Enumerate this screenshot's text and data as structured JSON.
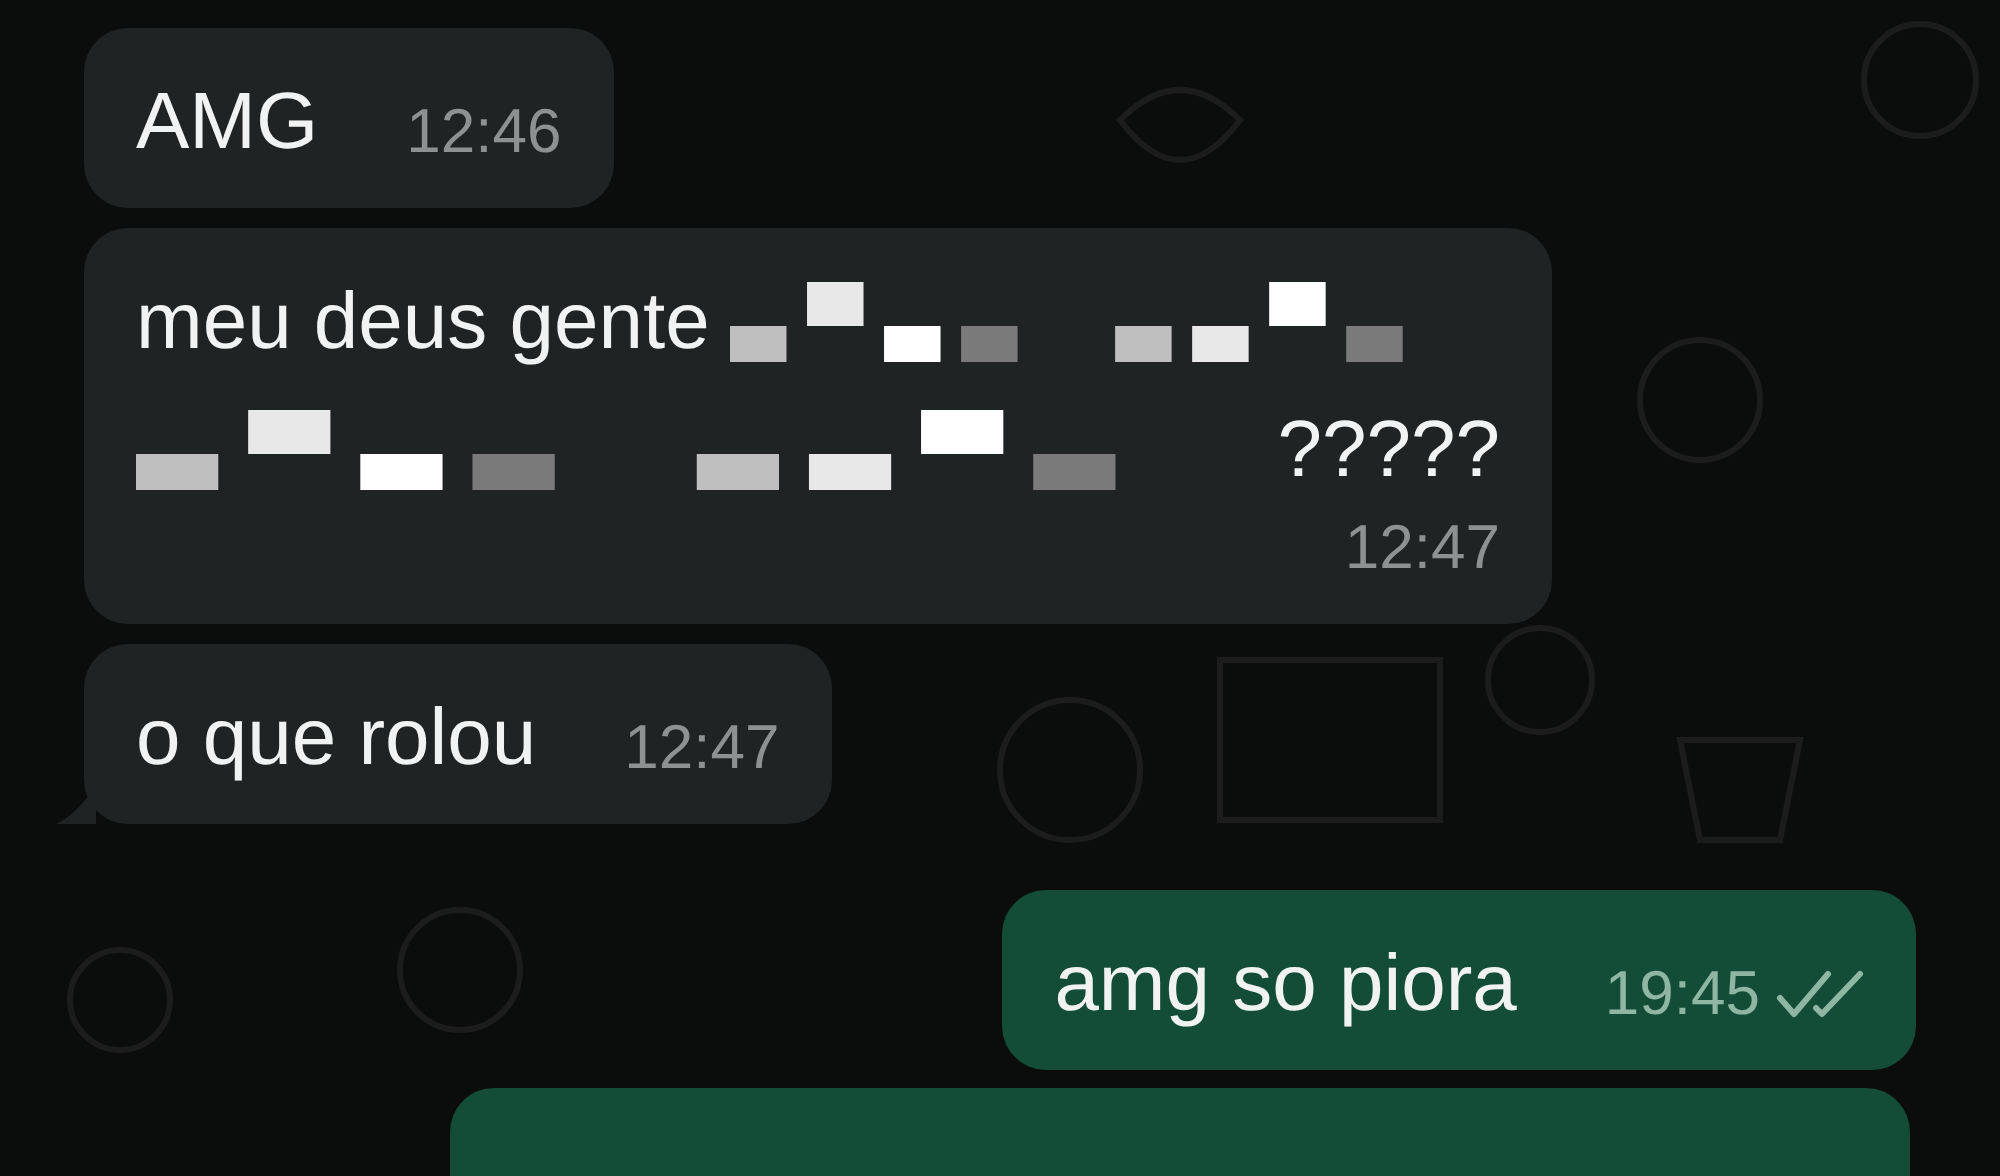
{
  "messages": [
    {
      "kind": "incoming",
      "lines": [
        [
          {
            "kind": "text",
            "text": "AMG"
          }
        ]
      ],
      "time": "12:46"
    },
    {
      "kind": "incoming",
      "lines": [
        [
          {
            "kind": "text",
            "text": "meu deus gente"
          },
          {
            "kind": "redacted"
          }
        ],
        [
          {
            "kind": "redacted"
          },
          {
            "kind": "text",
            "text": "?????"
          }
        ]
      ],
      "time": "12:47"
    },
    {
      "kind": "incoming",
      "tail": true,
      "lines": [
        [
          {
            "kind": "text",
            "text": "o que rolou"
          }
        ]
      ],
      "time": "12:47"
    },
    {
      "kind": "outgoing",
      "lines": [
        [
          {
            "kind": "text",
            "text": "amg so piora"
          }
        ]
      ],
      "time": "19:45",
      "read": false
    },
    {
      "kind": "outgoing"
    }
  ]
}
